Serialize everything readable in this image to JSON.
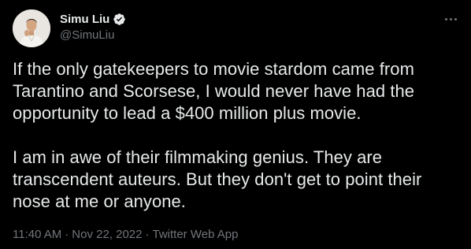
{
  "author": {
    "display_name": "Simu Liu",
    "handle": "@SimuLiu",
    "verified_icon": "verified-badge-icon",
    "avatar_icon": "profile-avatar"
  },
  "tweet": {
    "paragraphs": [
      "If the only gatekeepers to movie stardom came from Tarantino and Scorsese, I would never have had the opportunity to lead a $400 million plus movie.",
      "I am in awe of their filmmaking genius. They are transcendent auteurs. But they don't get to point their nose at me or anyone."
    ]
  },
  "meta": {
    "time": "11:40 AM",
    "separator": "·",
    "date": "Nov 22, 2022",
    "source": "Twitter Web App"
  },
  "menu": {
    "icon": "more-options-icon"
  },
  "colors": {
    "background": "#000000",
    "primary_text": "#e7e9ea",
    "secondary_text": "#71767b"
  }
}
